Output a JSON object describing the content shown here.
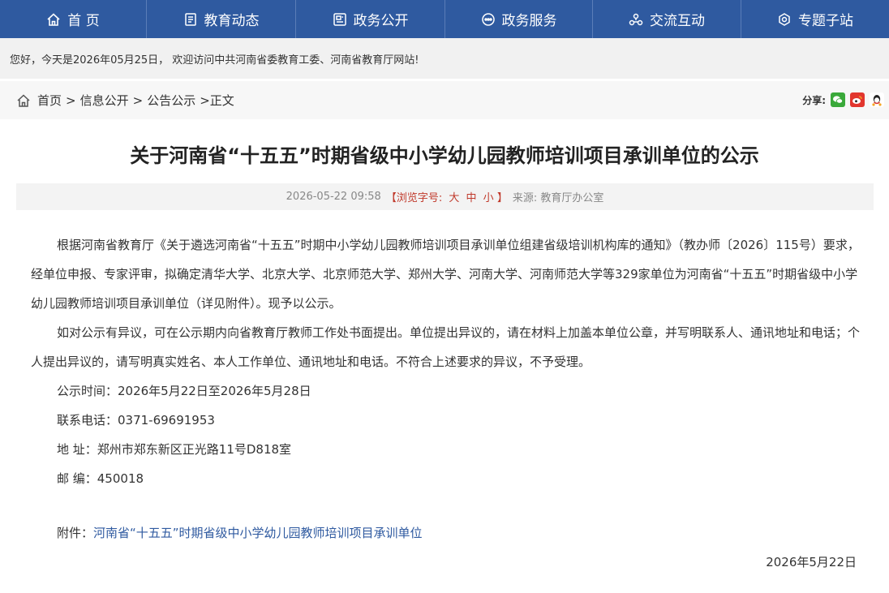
{
  "nav": {
    "items": [
      {
        "label": "首 页",
        "icon": "home-icon"
      },
      {
        "label": "教育动态",
        "icon": "news-icon"
      },
      {
        "label": "政务公开",
        "icon": "document-icon"
      },
      {
        "label": "政务服务",
        "icon": "service-icon"
      },
      {
        "label": "交流互动",
        "icon": "interaction-icon"
      },
      {
        "label": "专题子站",
        "icon": "topic-icon"
      }
    ]
  },
  "welcome": "您好，今天是2026年05月25日， 欢迎访问中共河南省委教育工委、河南省教育厅网站!",
  "breadcrumb": {
    "home": "首页",
    "sep": ">",
    "level1": "信息公开",
    "level2": "公告公示",
    "current": "正文"
  },
  "share": {
    "label": "分享:"
  },
  "article": {
    "title": "关于河南省“十五五”时期省级中小学幼儿园教师培训项目承训单位的公示",
    "datetime": "2026-05-22 09:58",
    "fontsize_label": "【浏览字号:",
    "fontsize_large": "大",
    "fontsize_medium": "中",
    "fontsize_small": "小",
    "fontsize_close": "】",
    "source": "来源: 教育厅办公室",
    "para1": "根据河南省教育厅《关于遴选河南省“十五五”时期中小学幼儿园教师培训项目承训单位组建省级培训机构库的通知》（教办师〔2026〕115号）要求，经单位申报、专家评审，拟确定清华大学、北京大学、北京师范大学、郑州大学、河南大学、河南师范大学等329家单位为河南省“十五五”时期省级中小学幼儿园教师培训项目承训单位（详见附件）。现予以公示。",
    "para2": "如对公示有异议，可在公示期内向省教育厅教师工作处书面提出。单位提出异议的，请在材料上加盖本单位公章，并写明联系人、通讯地址和电话；个人提出异议的，请写明真实姓名、本人工作单位、通讯地址和电话。不符合上述要求的异议，不予受理。",
    "period": "公示时间：2026年5月22日至2026年5月28日",
    "phone": "联系电话：0371-69691953",
    "address": "地 址：郑州市郑东新区正光路11号D818室",
    "postcode": "邮 编：450018",
    "attachment_label": "附件：",
    "attachment_link": "河南省“十五五”时期省级中小学幼儿园教师培训项目承训单位",
    "sign_date": "2026年5月22日"
  },
  "colors": {
    "nav_bg": "#2f5aa0",
    "link": "#2f5aa0",
    "fontsize_red": "#c0392b"
  }
}
